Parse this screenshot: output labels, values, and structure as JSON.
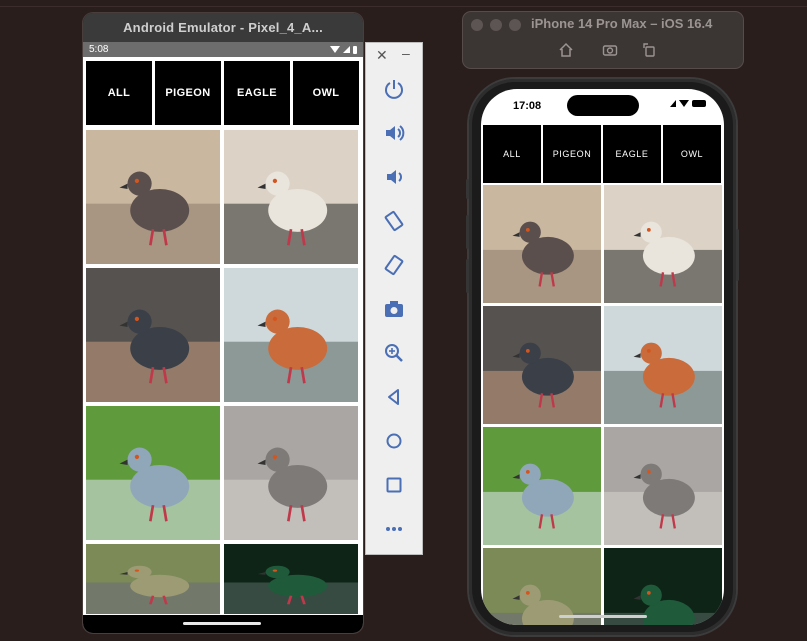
{
  "android": {
    "title": "Android Emulator - Pixel_4_A...",
    "status_time": "5:08",
    "tabs": [
      "ALL",
      "PIGEON",
      "EAGLE",
      "OWL"
    ]
  },
  "toolbar": {
    "close": "✕",
    "minimize": "–",
    "buttons": [
      "power-icon",
      "volume-up-icon",
      "volume-down-icon",
      "rotate-left-icon",
      "rotate-right-icon",
      "camera-icon",
      "zoom-icon",
      "back-icon",
      "home-icon",
      "overview-icon",
      "more-icon"
    ]
  },
  "ios": {
    "title": "iPhone 14 Pro Max – iOS 16.4",
    "status_time": "17:08",
    "tabs": [
      "ALL",
      "PIGEON",
      "EAGLE",
      "OWL"
    ]
  },
  "photos": [
    {
      "name": "pigeon-flock-photo",
      "colors": [
        "#c9b7a0",
        "#5a4f4c",
        "#8c7a6a"
      ]
    },
    {
      "name": "pigeon-standing-photo",
      "colors": [
        "#dcd3c6",
        "#e9e4dc",
        "#2a2a2a"
      ]
    },
    {
      "name": "pigeon-on-hand-photo",
      "colors": [
        "#56524f",
        "#3b3f47",
        "#c99a7f"
      ]
    },
    {
      "name": "pigeon-closeup-photo",
      "colors": [
        "#cfd9dc",
        "#c96b3b",
        "#55645e"
      ]
    },
    {
      "name": "pigeon-green-bg-photo",
      "colors": [
        "#5f9a3c",
        "#8fa7b8",
        "#dfe6ef"
      ]
    },
    {
      "name": "pigeon-pavement-photo",
      "colors": [
        "#a9a6a3",
        "#7d7a78",
        "#d7d4d0"
      ]
    },
    {
      "name": "pigeon-blurred-photo",
      "colors": [
        "#7b8a56",
        "#9c9b74",
        "#6b6a7c"
      ]
    },
    {
      "name": "pigeon-dark-photo",
      "colors": [
        "#0d2417",
        "#1f5a3a",
        "#5d6b67"
      ]
    }
  ]
}
